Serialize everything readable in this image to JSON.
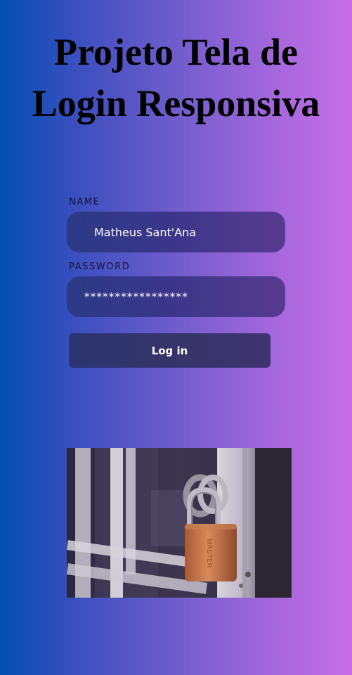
{
  "header": {
    "title_line1": "Projeto Tela de",
    "title_line2": "Login Responsiva"
  },
  "form": {
    "name_label": "NAME",
    "name_value": "Matheus Sant'Ana",
    "password_label": "PASSWORD",
    "password_value": "*****************",
    "login_button": "Log in"
  },
  "image": {
    "subject": "padlock-photo"
  },
  "colors": {
    "gradient_left": "#0050b2",
    "gradient_right": "#c66ee6",
    "field_bg": "#3a3689",
    "button_bg": "#353468",
    "text_on_dark": "#ffffff"
  }
}
